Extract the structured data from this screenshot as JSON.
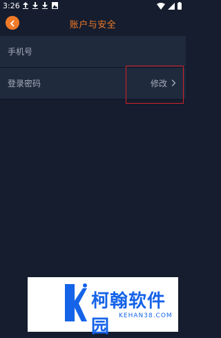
{
  "status_bar": {
    "time": "3:26",
    "icons": [
      "upload-icon",
      "download-icon",
      "download-icon",
      "image-icon",
      "wifi-icon",
      "signal-icon",
      "battery-icon"
    ]
  },
  "header": {
    "title": "账户与安全",
    "accent_color": "#f07a28"
  },
  "settings": {
    "phone_label": "手机号",
    "phone_value": "",
    "password_label": "登录密码",
    "password_action": "修改"
  },
  "watermark": {
    "name": "柯翰软件园",
    "domain": "KEHAN38.COM"
  }
}
